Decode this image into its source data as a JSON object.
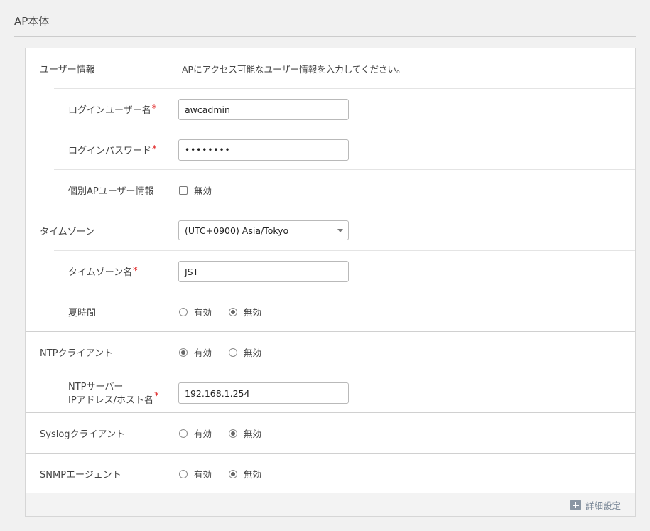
{
  "page": {
    "title": "AP本体"
  },
  "user_info": {
    "label": "ユーザー情報",
    "description": "APにアクセス可能なユーザー情報を入力してください。",
    "login_user": {
      "label": "ログインユーザー名",
      "required": "*",
      "value": "awcadmin"
    },
    "login_password": {
      "label": "ログインパスワード",
      "required": "*",
      "value": "••••••••"
    },
    "individual_ap_user": {
      "label": "個別APユーザー情報",
      "checkbox_label": "無効",
      "checked": false
    }
  },
  "timezone": {
    "label": "タイムゾーン",
    "selected": "(UTC+0900) Asia/Tokyo",
    "name": {
      "label": "タイムゾーン名",
      "required": "*",
      "value": "JST"
    },
    "dst": {
      "label": "夏時間",
      "options": [
        "有効",
        "無効"
      ],
      "selected": "無効"
    }
  },
  "ntp": {
    "label": "NTPクライアント",
    "options": [
      "有効",
      "無効"
    ],
    "selected": "有効",
    "server": {
      "label_line1": "NTPサーバー",
      "label_line2": "IPアドレス/ホスト名",
      "required": "*",
      "value": "192.168.1.254"
    }
  },
  "syslog": {
    "label": "Syslogクライアント",
    "options": [
      "有効",
      "無効"
    ],
    "selected": "無効"
  },
  "snmp": {
    "label": "SNMPエージェント",
    "options": [
      "有効",
      "無効"
    ],
    "selected": "無効"
  },
  "footer": {
    "advanced_label": "詳細設定"
  }
}
